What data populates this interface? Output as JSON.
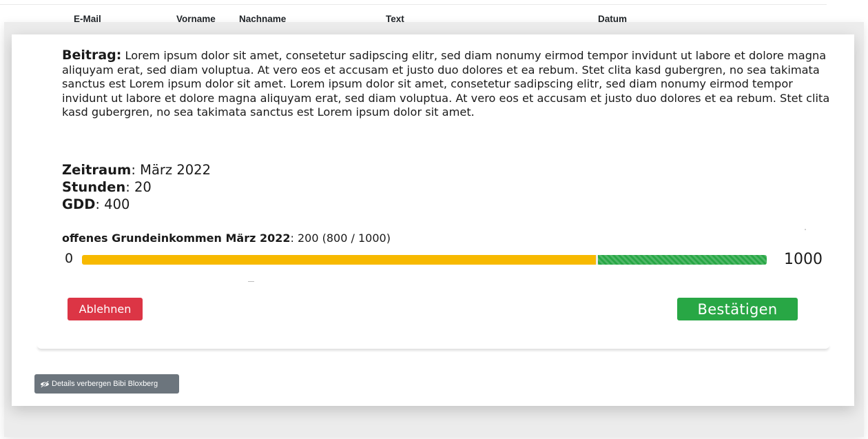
{
  "table": {
    "headers": [
      "E-Mail",
      "Vorname",
      "Nachname",
      "Text",
      "Datum"
    ]
  },
  "details": {
    "post_label": "Beitrag",
    "post_text": "Lorem ipsum dolor sit amet, consetetur sadipscing elitr, sed diam nonumy eirmod tempor invidunt ut labore et dolore magna aliquyam erat, sed diam voluptua. At vero eos et accusam et justo duo dolores et ea rebum. Stet clita kasd gubergren, no sea takimata sanctus est Lorem ipsum dolor sit amet. Lorem ipsum dolor sit amet, consetetur sadipscing elitr, sed diam nonumy eirmod tempor invidunt ut labore et dolore magna aliquyam erat, sed diam voluptua. At vero eos et accusam et justo duo dolores et ea rebum. Stet clita kasd gubergren, no sea takimata sanctus est Lorem ipsum dolor sit amet.",
    "period_label": "Zeitraum",
    "period_value": "März 2022",
    "hours_label": "Stunden",
    "hours_value": "20",
    "gdd_label": "GDD",
    "gdd_value": "400",
    "basic_income_label": "offenes Grundeinkommen März 2022",
    "basic_income_value": "200 (800 / 1000)",
    "range_min": "0",
    "range_max": "1000",
    "progress_used_fraction": 0.75,
    "progress_open_fraction": 0.25,
    "colors": {
      "used": "#f7b900",
      "open": "#28a745",
      "reject": "#dc3545",
      "confirm": "#28a745",
      "secondary": "#6c757d"
    }
  },
  "actions": {
    "reject_label": "Ablehnen",
    "confirm_label": "Bestätigen",
    "hide_details_label": "Details verbergen Bibi Bloxberg",
    "hide_details_icon": "eye-slash-icon"
  }
}
